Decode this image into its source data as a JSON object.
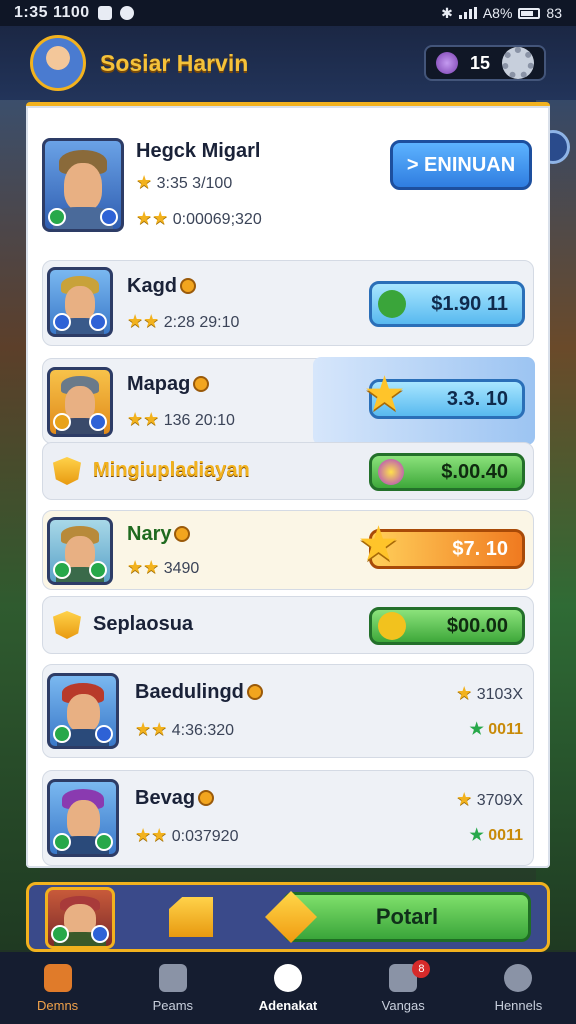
{
  "status_bar": {
    "time": "1:35 1100",
    "battery": "A8%",
    "extra": "83"
  },
  "header": {
    "title": "Sosiar Harvin",
    "currency_value": "15"
  },
  "top_player": {
    "name": "Hegck Migarl",
    "line1": "3:35 3/100",
    "line2": "0:00069;320",
    "button": "> ENINUAN"
  },
  "rows": [
    {
      "name": "Kagd",
      "stats": "2:28 29:10",
      "price": "$1.90 11"
    },
    {
      "name": "Mapag",
      "stats": "136 20:10",
      "price": "3.3. 10"
    },
    {
      "name": "Nary",
      "stats": "3490",
      "price": "$7. 10"
    }
  ],
  "sections": [
    {
      "label": "Mingiupladiayan",
      "price": "$.00.40"
    },
    {
      "label": "Seplaosua",
      "price": "$00.00"
    }
  ],
  "badge_rows": [
    {
      "name": "Baedulingd",
      "stats": "4:36:320",
      "top": "3103X",
      "bottom": "0011"
    },
    {
      "name": "Bevag",
      "stats": "0:037920",
      "top": "3709X",
      "bottom": "0011"
    }
  ],
  "cta": {
    "label": "Potarl"
  },
  "nav": [
    {
      "label": "Demns"
    },
    {
      "label": "Peams"
    },
    {
      "label": "Adenakat"
    },
    {
      "label": "Vangas",
      "badge": "8"
    },
    {
      "label": "Hennels"
    }
  ]
}
